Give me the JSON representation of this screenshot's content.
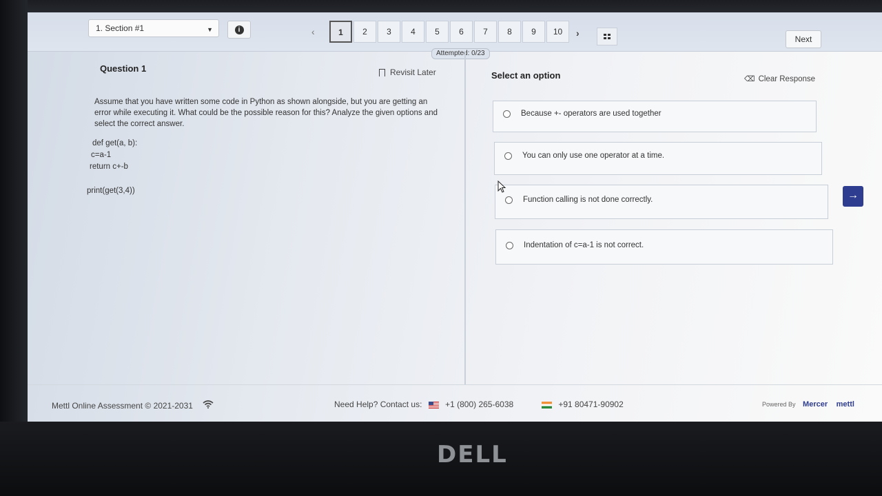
{
  "header": {
    "section_label": "1. Section #1",
    "pages": [
      "1",
      "2",
      "3",
      "4",
      "5",
      "6",
      "7",
      "8",
      "9",
      "10"
    ],
    "active_page": "1",
    "next_label": "Next",
    "attempted": "Attempted: 0/23"
  },
  "question": {
    "title": "Question 1",
    "revisit_label": "Revisit Later",
    "text": "Assume that you have written some code in Python as shown alongside, but you are getting an error while executing it. What could be the possible reason for this? Analyze the given options and select the correct answer.",
    "code": [
      "def get(a, b):",
      "c=a-1",
      "return c+-b",
      "print(get(3,4))"
    ]
  },
  "answers": {
    "heading": "Select an option",
    "clear_label": "Clear Response",
    "options": [
      "Because +- operators are used together",
      "You can only use one operator at a time.",
      "Function calling is not done correctly.",
      "Indentation of c=a-1 is not correct."
    ]
  },
  "footer": {
    "copyright": "Mettl Online Assessment © 2021-2031",
    "help_label": "Need Help? Contact us:",
    "phone_us": "+1 (800) 265-6038",
    "phone_in": "+91 80471-90902",
    "powered_by": "Powered By",
    "mercer": "Mercer",
    "mettl": "mettl"
  },
  "device": {
    "brand": "DELL"
  }
}
